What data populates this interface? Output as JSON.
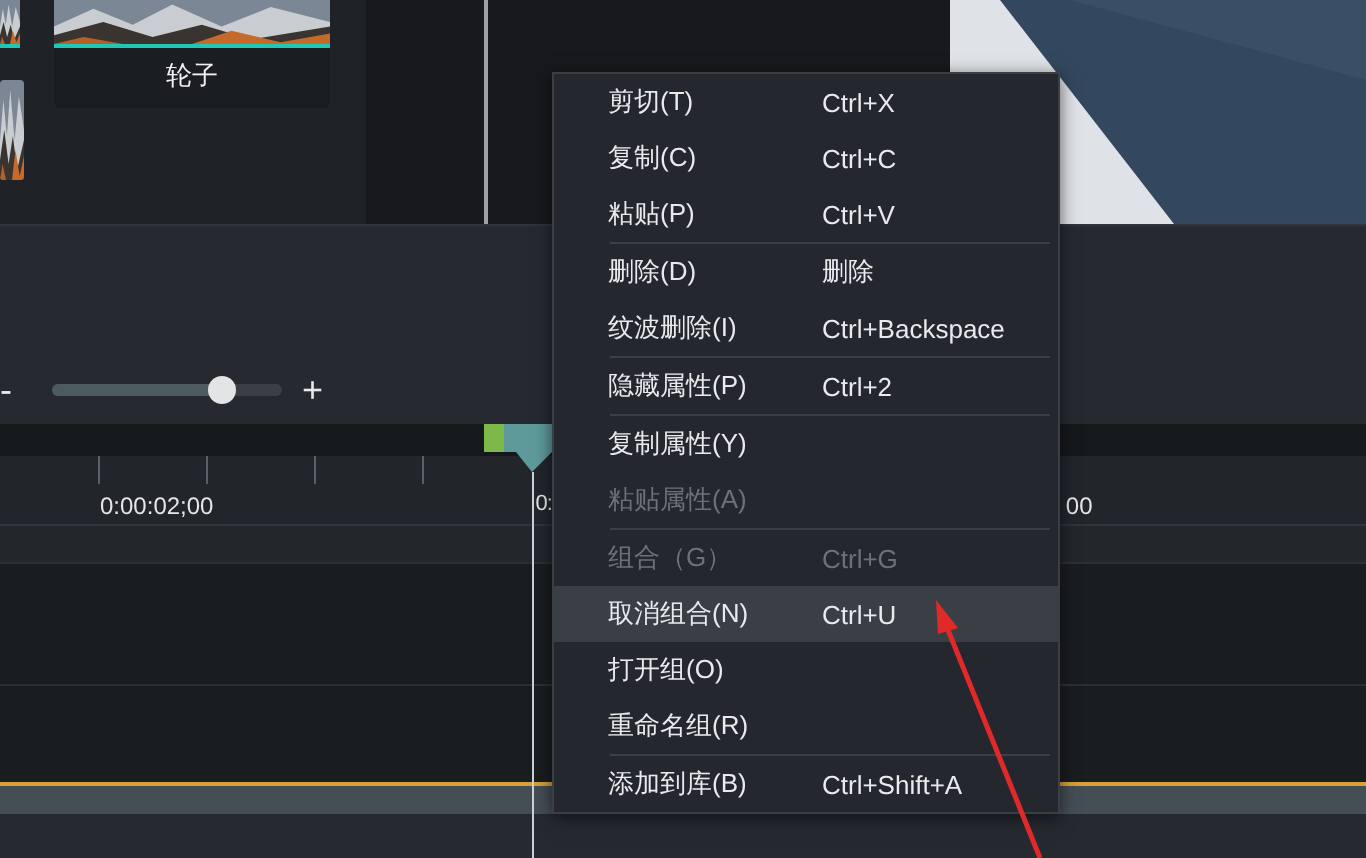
{
  "media_bin": {
    "clips": [
      {
        "label": "轮子"
      }
    ]
  },
  "zoom": {
    "minus": "-",
    "plus": "+",
    "level": 0.74
  },
  "ruler": {
    "labels": [
      "0:00:02;00",
      "0:",
      "00"
    ]
  },
  "context_menu": {
    "sections": [
      [
        {
          "label": "剪切(T)",
          "shortcut": "Ctrl+X",
          "disabled": false,
          "selected": false
        },
        {
          "label": "复制(C)",
          "shortcut": "Ctrl+C",
          "disabled": false,
          "selected": false
        },
        {
          "label": "粘贴(P)",
          "shortcut": "Ctrl+V",
          "disabled": false,
          "selected": false
        }
      ],
      [
        {
          "label": "删除(D)",
          "shortcut": "删除",
          "disabled": false,
          "selected": false
        },
        {
          "label": "纹波删除(I)",
          "shortcut": "Ctrl+Backspace",
          "disabled": false,
          "selected": false
        }
      ],
      [
        {
          "label": "隐藏属性(P)",
          "shortcut": "Ctrl+2",
          "disabled": false,
          "selected": false
        }
      ],
      [
        {
          "label": "复制属性(Y)",
          "disabled": false,
          "selected": false
        },
        {
          "label": "粘贴属性(A)",
          "disabled": true,
          "selected": false
        }
      ],
      [
        {
          "label": "组合（G）",
          "shortcut": "Ctrl+G",
          "disabled": true,
          "selected": false
        },
        {
          "label": "取消组合(N)",
          "shortcut": "Ctrl+U",
          "disabled": false,
          "selected": true
        },
        {
          "label": "打开组(O)",
          "disabled": false,
          "selected": false
        },
        {
          "label": "重命名组(R)",
          "disabled": false,
          "selected": false
        }
      ],
      [
        {
          "label": "添加到库(B)",
          "shortcut": "Ctrl+Shift+A",
          "disabled": false,
          "selected": false
        }
      ]
    ]
  }
}
